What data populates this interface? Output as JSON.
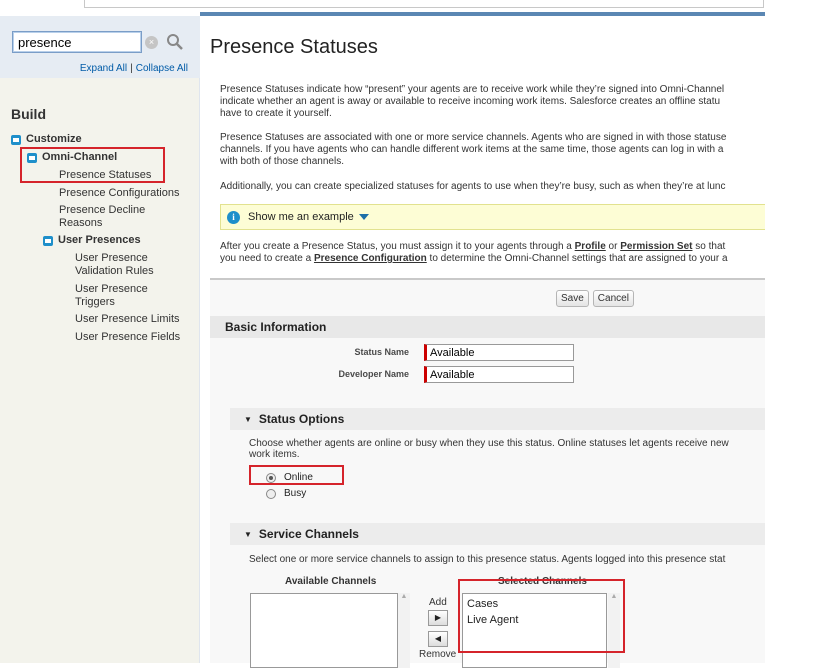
{
  "sidebar": {
    "search_value": "presence",
    "expand_all": "Expand All",
    "separator": "|",
    "collapse_all": "Collapse All",
    "build_heading": "Build",
    "items": [
      {
        "label": "Customize"
      },
      {
        "label": "Omni-Channel"
      },
      {
        "label": "Presence Statuses"
      },
      {
        "label": "Presence Configurations"
      },
      {
        "label": "Presence Decline Reasons"
      },
      {
        "label": "User Presences"
      },
      {
        "label": "User Presence Validation Rules"
      },
      {
        "label": "User Presence Triggers"
      },
      {
        "label": "User Presence Limits"
      },
      {
        "label": "User Presence Fields"
      }
    ]
  },
  "main": {
    "title": "Presence Statuses",
    "para1": "Presence Statuses indicate how “present” your agents are to receive work while they’re signed into Omni-Channel\nindicate whether an agent is away or available to receive incoming work items. Salesforce creates an offline statu\nhave to create it yourself.",
    "para2": "Presence Statuses are associated with one or more service channels. Agents who are signed in with those statuse\nchannels. If you have agents who can handle different work items at the same time, those agents can log in with a\nwith both of those channels.",
    "para3": "Additionally, you can create specialized statuses for agents to use when they’re busy, such as when they’re at lunc",
    "example_label": "Show me an example",
    "para4_a": "After you create a Presence Status, you must assign it to your agents through a ",
    "para4_profile": "Profile",
    "para4_or": " or ",
    "para4_permset": "Permission Set",
    "para4_b": " so that",
    "para4_c": "you need to create a ",
    "para4_presconf": "Presence Configuration",
    "para4_d": " to determine the Omni-Channel settings that are assigned to your a"
  },
  "form": {
    "save_label": "Save",
    "cancel_label": "Cancel",
    "basic_info_heading": "Basic Information",
    "status_name_label": "Status Name",
    "status_name_value": "Available",
    "developer_name_label": "Developer Name",
    "developer_name_value": "Available",
    "status_options_heading": "Status Options",
    "status_options_text": "Choose whether agents are online or busy when they use this status. Online statuses let agents receive new\nwork items.",
    "online_label": "Online",
    "busy_label": "Busy",
    "service_channels_heading": "Service Channels",
    "service_channels_text": "Select one or more service channels to assign to this presence status. Agents logged into this presence stat",
    "available_channels_label": "Available Channels",
    "selected_channels_label": "Selected Channels",
    "add_label": "Add",
    "remove_label": "Remove",
    "selected_channels": [
      "Cases",
      "Live Agent"
    ]
  },
  "colors": {
    "highlight": "#d5242b",
    "link": "#015ba7",
    "accent": "#1e8fca"
  }
}
